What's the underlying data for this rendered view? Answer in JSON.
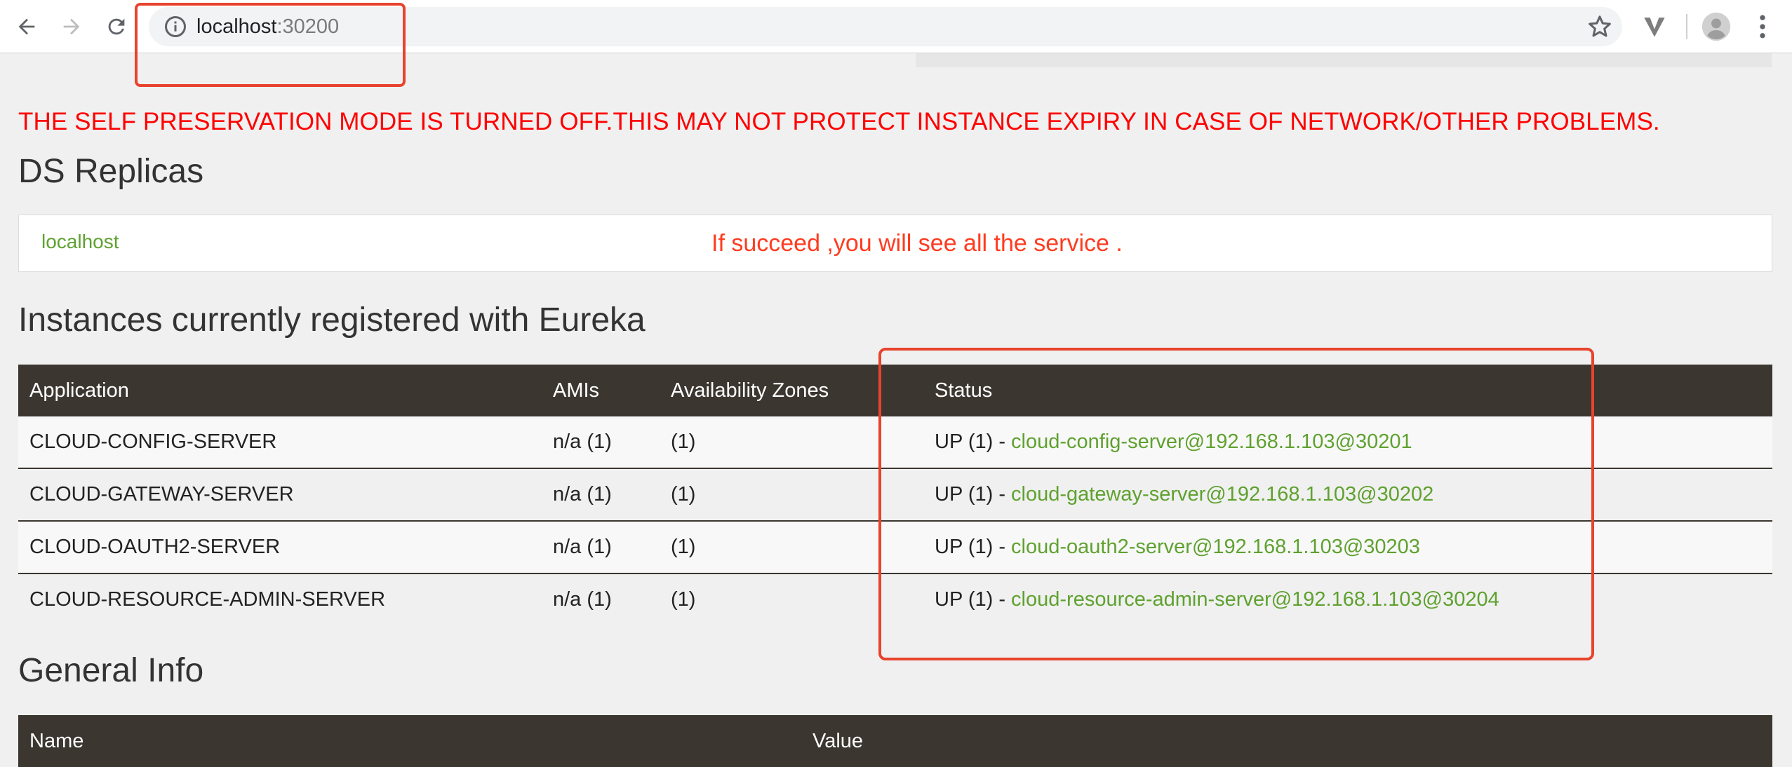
{
  "browser": {
    "url_host": "localhost",
    "url_port": ":30200"
  },
  "page": {
    "warning": "THE SELF PRESERVATION MODE IS TURNED OFF.THIS MAY NOT PROTECT INSTANCE EXPIRY IN CASE OF NETWORK/OTHER PROBLEMS.",
    "ds_replicas_title": "DS Replicas",
    "replica_link": "localhost",
    "annotation": "If succeed ,you will see all the service .",
    "instances_title": "Instances currently registered with Eureka",
    "instances_table": {
      "headers": [
        "Application",
        "AMIs",
        "Availability Zones",
        "Status"
      ],
      "rows": [
        {
          "app": "CLOUD-CONFIG-SERVER",
          "amis": "n/a (1)",
          "zones": "(1)",
          "status_prefix": "UP (1) - ",
          "instance": "cloud-config-server@192.168.1.103@30201"
        },
        {
          "app": "CLOUD-GATEWAY-SERVER",
          "amis": "n/a (1)",
          "zones": "(1)",
          "status_prefix": "UP (1) - ",
          "instance": "cloud-gateway-server@192.168.1.103@30202"
        },
        {
          "app": "CLOUD-OAUTH2-SERVER",
          "amis": "n/a (1)",
          "zones": "(1)",
          "status_prefix": "UP (1) - ",
          "instance": "cloud-oauth2-server@192.168.1.103@30203"
        },
        {
          "app": "CLOUD-RESOURCE-ADMIN-SERVER",
          "amis": "n/a (1)",
          "zones": "(1)",
          "status_prefix": "UP (1) - ",
          "instance": "cloud-resource-admin-server@192.168.1.103@30204"
        }
      ]
    },
    "general_info_title": "General Info",
    "general_table": {
      "headers": [
        "Name",
        "Value"
      ]
    }
  },
  "colors": {
    "warning": "#ff0000",
    "link": "#5fa12f",
    "header_bg": "#3b3630",
    "annotation": "#ff3b1f",
    "highlight_border": "#e8432d"
  },
  "icons": [
    "back-arrow-icon",
    "forward-arrow-icon",
    "reload-icon",
    "info-icon",
    "bookmark-star-icon",
    "extension-icon",
    "profile-avatar-icon",
    "menu-dots-icon"
  ]
}
